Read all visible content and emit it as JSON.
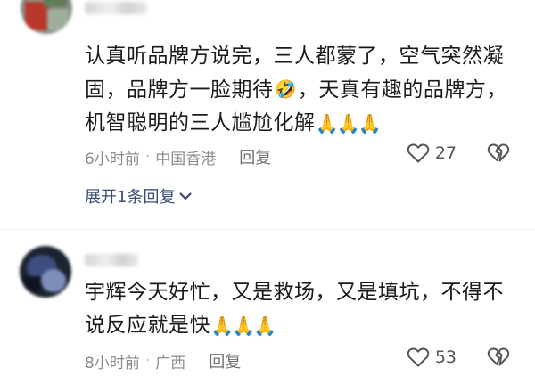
{
  "comments": [
    {
      "text_lines": [
        "认真听品牌方说完，三人都蒙了，空气突然凝",
        "固，品牌方一脸期待",
        "，天真有趣的品牌方，",
        "机智聪明的三人尴尬化解"
      ],
      "emoji_laugh": "🤣",
      "emoji_hands": "🙏🙏🙏",
      "time": "6小时前",
      "location": "中国香港",
      "reply_label": "回复",
      "like_count": "27",
      "expand_label": "展开1条回复"
    },
    {
      "text_lines": [
        "宇辉今天好忙，又是救场，又是填坑，不得不",
        "说反应就是快"
      ],
      "emoji_hands": "🙏🙏🙏",
      "time": "8小时前",
      "location": "广西",
      "reply_label": "回复",
      "like_count": "53"
    }
  ],
  "separator": "·",
  "icons": {
    "like": "heart-outline-icon",
    "dislike": "broken-heart-icon",
    "expand": "chevron-down-icon"
  }
}
